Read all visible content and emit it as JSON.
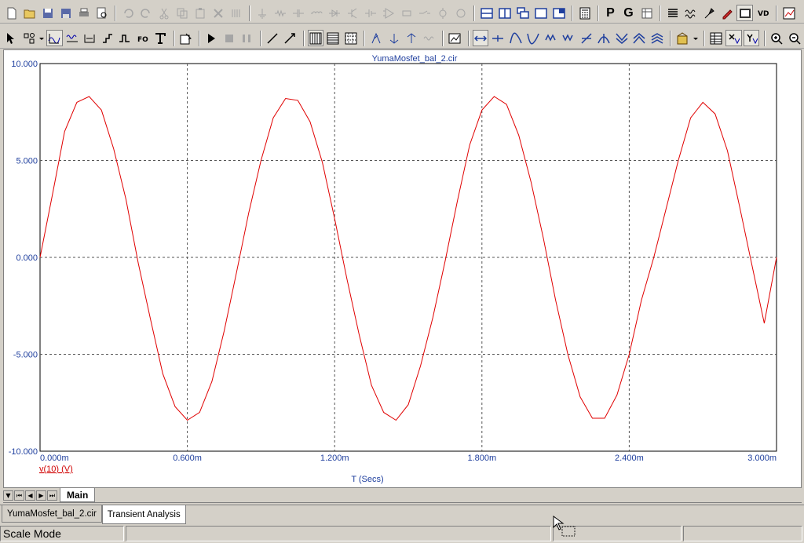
{
  "plot": {
    "title": "YumaMosfet_bal_2.cir",
    "xlabel": "T (Secs)",
    "trace_label": "v(10) (V)",
    "x_ticks": [
      "0.000m",
      "0.600m",
      "1.200m",
      "1.800m",
      "2.400m",
      "3.000m"
    ],
    "y_ticks": [
      "10.000",
      "5.000",
      "0.000",
      "-5.000",
      "-10.000"
    ]
  },
  "chart_data": {
    "type": "line",
    "title": "YumaMosfet_bal_2.cir",
    "xlabel": "T (Secs)",
    "ylabel": "",
    "xlim": [
      0,
      3.0
    ],
    "ylim": [
      -10,
      10
    ],
    "x_unit": "ms",
    "grid": true,
    "series": [
      {
        "name": "v(10) (V)",
        "color": "#e00000",
        "x": [
          0.0,
          0.05,
          0.1,
          0.15,
          0.2,
          0.25,
          0.3,
          0.35,
          0.4,
          0.45,
          0.5,
          0.55,
          0.6,
          0.65,
          0.7,
          0.75,
          0.8,
          0.85,
          0.9,
          0.95,
          1.0,
          1.05,
          1.1,
          1.15,
          1.2,
          1.25,
          1.3,
          1.35,
          1.4,
          1.45,
          1.5,
          1.55,
          1.6,
          1.65,
          1.7,
          1.75,
          1.8,
          1.85,
          1.9,
          1.95,
          2.0,
          2.05,
          2.1,
          2.15,
          2.2,
          2.25,
          2.3,
          2.35,
          2.4,
          2.45,
          2.5,
          2.55,
          2.6,
          2.65,
          2.7,
          2.75,
          2.8,
          2.85,
          2.9,
          2.95,
          3.0
        ],
        "y": [
          0.0,
          3.2,
          6.5,
          8.0,
          8.3,
          7.6,
          5.6,
          3.0,
          -0.3,
          -3.2,
          -6.0,
          -7.7,
          -8.4,
          -8.0,
          -6.4,
          -3.8,
          -0.8,
          2.3,
          5.0,
          7.2,
          8.2,
          8.1,
          7.0,
          4.9,
          2.0,
          -1.1,
          -4.0,
          -6.6,
          -8.0,
          -8.4,
          -7.6,
          -5.6,
          -3.1,
          -0.2,
          2.9,
          5.8,
          7.6,
          8.3,
          7.9,
          6.3,
          3.9,
          1.0,
          -2.2,
          -5.0,
          -7.2,
          -8.3,
          -8.3,
          -7.1,
          -5.0,
          -2.2,
          0.0,
          2.5,
          5.0,
          7.2,
          8.0,
          7.4,
          5.5,
          2.6,
          -0.4,
          -3.4,
          0.0
        ]
      }
    ]
  },
  "sheet_tab": "Main",
  "file_tabs": [
    "YumaMosfet_bal_2.cir",
    "Transient Analysis"
  ],
  "status": {
    "mode": "Scale Mode"
  },
  "toolbar": {
    "p_label": "P",
    "g_label": "G"
  }
}
